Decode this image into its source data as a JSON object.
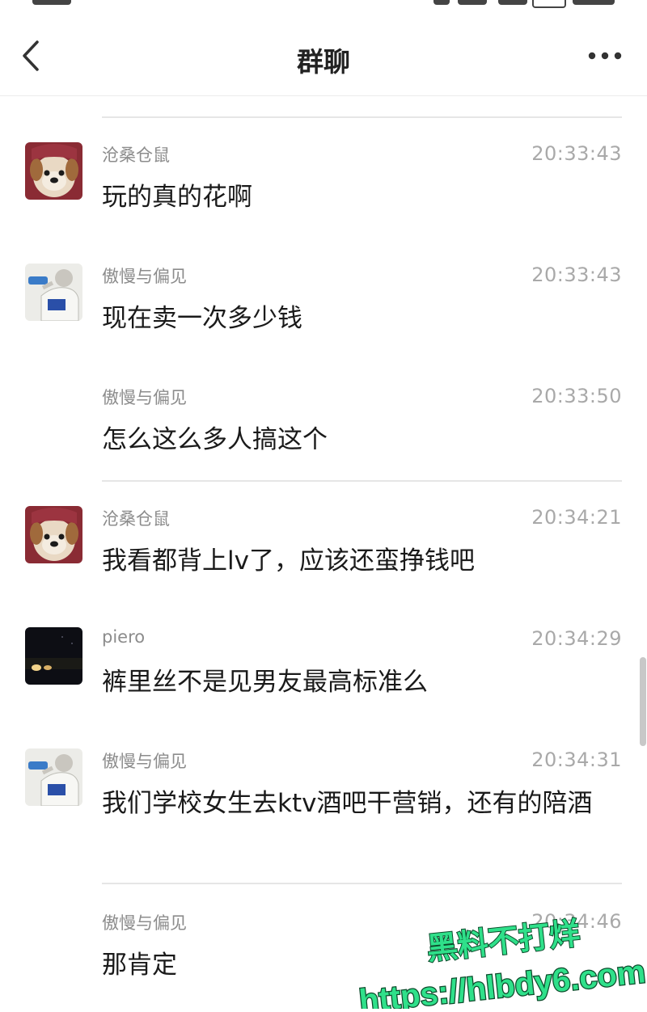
{
  "header": {
    "title": "群聊"
  },
  "messages": [
    {
      "sender": "沧桑仓鼠",
      "time": "20:33:43",
      "text": "玩的真的花啊",
      "avatar": "dog"
    },
    {
      "sender": "傲慢与偏见",
      "time": "20:33:43",
      "text": "现在卖一次多少钱",
      "avatar": "person"
    },
    {
      "sender": "傲慢与偏见",
      "time": "20:33:50",
      "text": "怎么这么多人搞这个",
      "avatar": ""
    },
    {
      "sender": "沧桑仓鼠",
      "time": "20:34:21",
      "text": "我看都背上lv了，应该还蛮挣钱吧",
      "avatar": "dog"
    },
    {
      "sender": "piero",
      "time": "20:34:29",
      "text": "裤里丝不是见男友最高标准么",
      "avatar": "night"
    },
    {
      "sender": "傲慢与偏见",
      "time": "20:34:31",
      "text": "我们学校女生去ktv酒吧干营销，还有的陪酒",
      "avatar": "person"
    },
    {
      "sender": "傲慢与偏见",
      "time": "20:34:46",
      "text": "那肯定",
      "avatar": ""
    }
  ],
  "watermark": {
    "line1": "黑料不打烊",
    "line2": "https://hlbdy6.com"
  },
  "icons": [
    "back-arrow-icon",
    "more-dots-icon"
  ],
  "colors": {
    "background": "#ffffff",
    "time_text": "#a9a9a9",
    "sender_text": "#8c8c8c",
    "watermark_green": "#2fe08a"
  }
}
